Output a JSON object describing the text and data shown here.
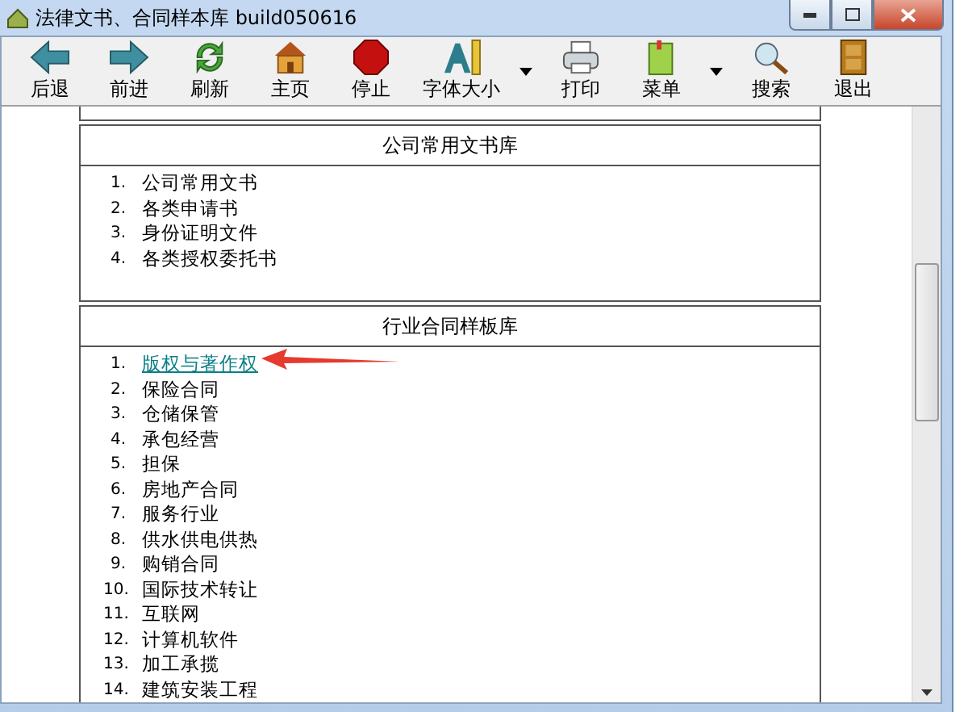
{
  "window": {
    "title": "法律文书、合同样本库 build050616"
  },
  "toolbar": [
    {
      "label": "后退",
      "has_menu": false
    },
    {
      "label": "前进",
      "has_menu": false
    },
    {
      "label": "刷新",
      "has_menu": false
    },
    {
      "label": "主页",
      "has_menu": false
    },
    {
      "label": "停止",
      "has_menu": false
    },
    {
      "label": "字体大小",
      "has_menu": true
    },
    {
      "label": "打印",
      "has_menu": false
    },
    {
      "label": "菜单",
      "has_menu": true
    },
    {
      "label": "搜索",
      "has_menu": false
    },
    {
      "label": "退出",
      "has_menu": false
    }
  ],
  "sections": [
    {
      "title": "公司常用文书库",
      "items": [
        {
          "number": "1.",
          "label": "公司常用文书",
          "kind": "text"
        },
        {
          "number": "2.",
          "label": "各类申请书",
          "kind": "text"
        },
        {
          "number": "3.",
          "label": "身份证明文件",
          "kind": "text"
        },
        {
          "number": "4.",
          "label": "各类授权委托书",
          "kind": "text"
        }
      ]
    },
    {
      "title": "行业合同样板库",
      "items": [
        {
          "number": "1.",
          "label": "版权与著作权",
          "kind": "link"
        },
        {
          "number": "2.",
          "label": "保险合同",
          "kind": "text"
        },
        {
          "number": "3.",
          "label": "仓储保管",
          "kind": "text"
        },
        {
          "number": "4.",
          "label": "承包经营",
          "kind": "text"
        },
        {
          "number": "5.",
          "label": "担保",
          "kind": "text"
        },
        {
          "number": "6.",
          "label": "房地产合同",
          "kind": "text"
        },
        {
          "number": "7.",
          "label": "服务行业",
          "kind": "text"
        },
        {
          "number": "8.",
          "label": "供水供电供热",
          "kind": "text"
        },
        {
          "number": "9.",
          "label": "购销合同",
          "kind": "text"
        },
        {
          "number": "10.",
          "label": "国际技术转让",
          "kind": "text"
        },
        {
          "number": "11.",
          "label": "互联网",
          "kind": "text"
        },
        {
          "number": "12.",
          "label": "计算机软件",
          "kind": "text"
        },
        {
          "number": "13.",
          "label": "加工承揽",
          "kind": "text"
        },
        {
          "number": "14.",
          "label": "建筑安装工程",
          "kind": "text"
        }
      ]
    }
  ]
}
